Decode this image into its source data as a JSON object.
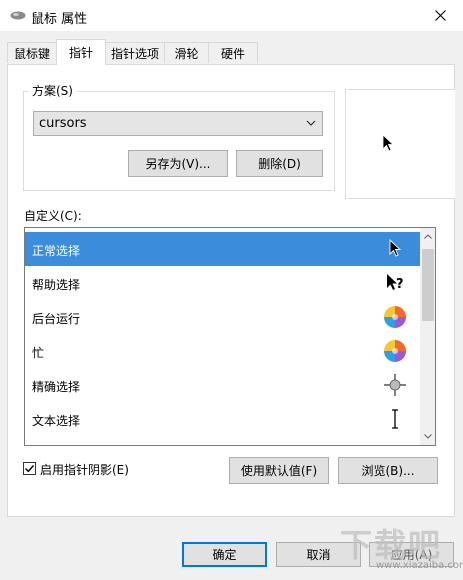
{
  "window": {
    "title": "鼠标 属性"
  },
  "tabs": [
    {
      "label": "鼠标键"
    },
    {
      "label": "指针"
    },
    {
      "label": "指针选项"
    },
    {
      "label": "滑轮"
    },
    {
      "label": "硬件"
    }
  ],
  "scheme": {
    "label": "方案(S)",
    "selected": "cursors",
    "save_as_label": "另存为(V)...",
    "delete_label": "删除(D)"
  },
  "customize": {
    "label": "自定义(C):",
    "items": [
      {
        "label": "正常选择",
        "icon": "arrow-cursor-icon",
        "selected": true
      },
      {
        "label": "帮助选择",
        "icon": "help-cursor-icon"
      },
      {
        "label": "后台运行",
        "icon": "busy-wheel-icon"
      },
      {
        "label": "忙",
        "icon": "busy-wheel-icon"
      },
      {
        "label": "精确选择",
        "icon": "crosshair-icon"
      },
      {
        "label": "文本选择",
        "icon": "ibeam-icon"
      }
    ]
  },
  "shadow": {
    "label": "启用指针阴影(E)",
    "checked": true
  },
  "use_default_label": "使用默认值(F)",
  "browse_label": "浏览(B)...",
  "footer": {
    "ok_label": "确定",
    "cancel_label": "取消",
    "apply_label": "应用(A)"
  },
  "watermark": {
    "text": "下载吧",
    "url": "www.xiazaiba.com"
  },
  "colors": {
    "selection": "#3b8ddc",
    "accent": "#0078d7"
  }
}
